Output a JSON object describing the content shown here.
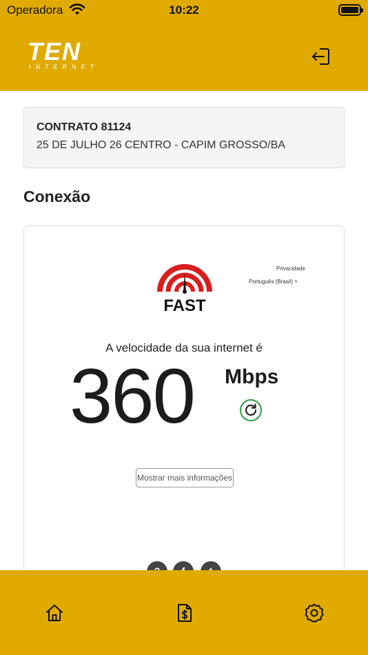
{
  "status_bar": {
    "carrier": "Operadora",
    "time": "10:22",
    "wifi_icon": "wifi-icon",
    "battery_icon": "battery-icon"
  },
  "header": {
    "logo_text": "TEN",
    "logo_subtext": "INTERNET",
    "logout_icon": "logout-icon",
    "brand_color": "#E0AA00"
  },
  "contract": {
    "title": "CONTRATO 81124",
    "address": "25 DE JULHO 26 CENTRO - CAPIM GROSSO/BA"
  },
  "section": {
    "title": "Conexão"
  },
  "speedtest": {
    "logo_text": "FAST",
    "privacy_link": "Privacidade",
    "language": "Português (Brasil) ˅",
    "caption": "A velocidade da sua internet é",
    "speed_value": "360",
    "speed_unit": "Mbps",
    "more_info_label": "Mostrar mais informações",
    "refresh_icon": "refresh-icon",
    "accent_red": "#D91E1E",
    "accent_green": "#2E9B3F",
    "social": {
      "help_glyph": "?",
      "facebook_glyph": "f",
      "twitter_glyph": "t"
    }
  },
  "bottom_nav": {
    "items": [
      {
        "name": "home",
        "icon": "home-icon"
      },
      {
        "name": "finance",
        "icon": "invoice-dollar-icon"
      },
      {
        "name": "settings",
        "icon": "gear-icon"
      }
    ]
  }
}
